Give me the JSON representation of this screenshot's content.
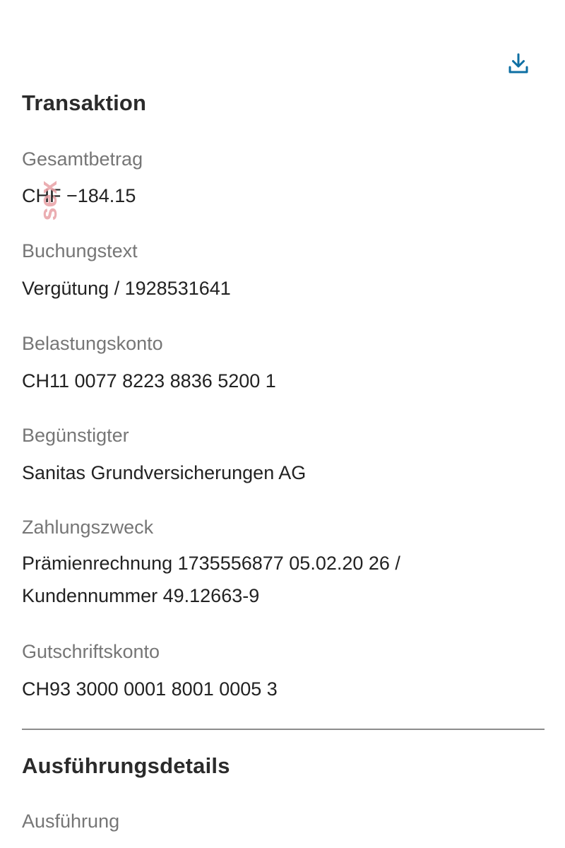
{
  "header": {
    "download_icon": "download-icon",
    "accent_color": "#0e6fa3"
  },
  "transaction": {
    "title": "Transaktion",
    "fields": [
      {
        "label": "Gesamtbetrag",
        "value": "CHF −184.15"
      },
      {
        "label": "Buchungstext",
        "value": "Vergütung / 1928531641"
      },
      {
        "label": "Belastungskonto",
        "value": "CH11 0077 8223 8836 5200 1"
      },
      {
        "label": "Begünstigter",
        "value": "Sanitas Grundversicherungen AG"
      },
      {
        "label": "Zahlungszweck",
        "value": "Prämienrechnung 1735556877 05.02.20 26 / Kundennummer 49.12663-9"
      },
      {
        "label": "Gutschriftskonto",
        "value": "CH93 3000 0001 8001 0005 3"
      }
    ]
  },
  "execution": {
    "title": "Ausführungsdetails",
    "fields": [
      {
        "label": "Ausführung"
      }
    ]
  },
  "watermark": {
    "text": "sex",
    "color": "#e8a0a4"
  }
}
